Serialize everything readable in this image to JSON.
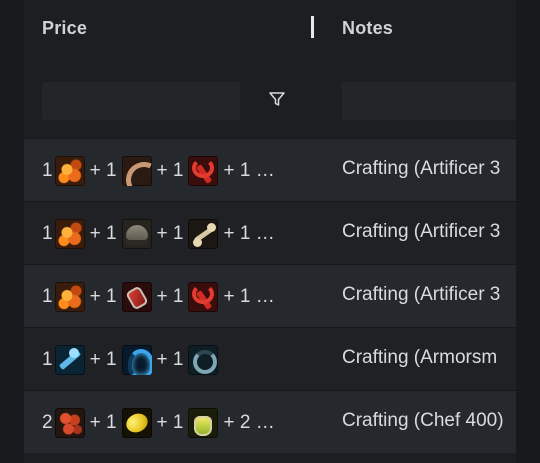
{
  "columns": {
    "price": "Price",
    "notes": "Notes"
  },
  "filter": {
    "price_placeholder": "",
    "notes_placeholder": ""
  },
  "rows": [
    {
      "price": [
        {
          "qty": "1",
          "icon": "ore-icon",
          "art": "ic-ore"
        },
        {
          "qty": "+ 1",
          "icon": "horn-icon",
          "art": "ic-horn"
        },
        {
          "qty": "+ 1",
          "icon": "wrench-icon",
          "art": "ic-wrench"
        }
      ],
      "more": "+ 1 …",
      "notes": "Crafting (Artificer 3"
    },
    {
      "price": [
        {
          "qty": "1",
          "icon": "ore-icon",
          "art": "ic-ore"
        },
        {
          "qty": "+ 1",
          "icon": "helmet-icon",
          "art": "ic-helm"
        },
        {
          "qty": "+ 1",
          "icon": "bone-icon",
          "art": "ic-bone"
        }
      ],
      "more": "+ 1 …",
      "notes": "Crafting (Artificer 3"
    },
    {
      "price": [
        {
          "qty": "1",
          "icon": "ore-icon",
          "art": "ic-ore"
        },
        {
          "qty": "+ 1",
          "icon": "flask-icon",
          "art": "ic-flask"
        },
        {
          "qty": "+ 1",
          "icon": "wrench-icon",
          "art": "ic-wrench"
        }
      ],
      "more": "+ 1 …",
      "notes": "Crafting (Artificer 3"
    },
    {
      "price": [
        {
          "qty": "1",
          "icon": "blue-tool-icon",
          "art": "ic-blue-tool"
        },
        {
          "qty": "+ 1",
          "icon": "blue-shield-icon",
          "art": "ic-blue-shield"
        },
        {
          "qty": "+ 1",
          "icon": "blue-ring-icon",
          "art": "ic-blue-ring"
        }
      ],
      "more": "",
      "notes": "Crafting (Armorsm"
    },
    {
      "price": [
        {
          "qty": "2",
          "icon": "berries-icon",
          "art": "ic-berries"
        },
        {
          "qty": "+ 1",
          "icon": "lemon-icon",
          "art": "ic-lemon"
        },
        {
          "qty": "+ 1",
          "icon": "oil-flask-icon",
          "art": "ic-oil"
        }
      ],
      "more": "+ 2 …",
      "notes": "Crafting (Chef 400)"
    }
  ]
}
